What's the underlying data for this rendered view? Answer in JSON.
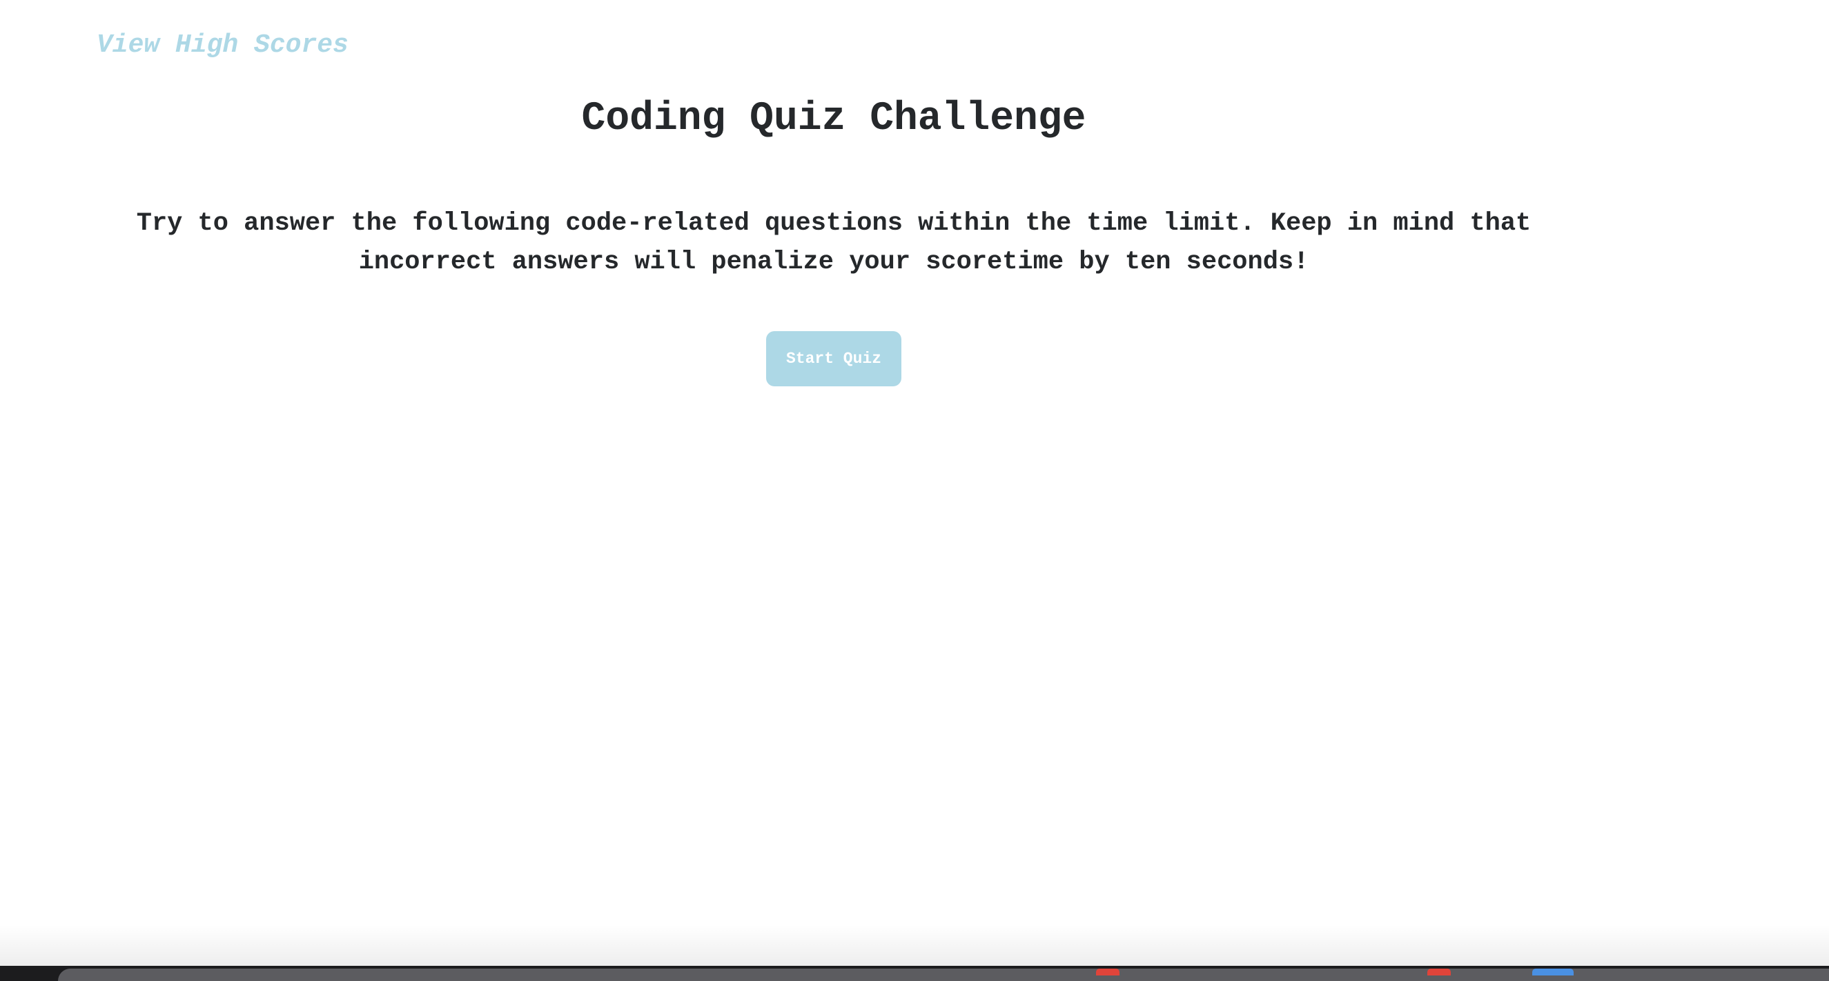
{
  "header": {
    "high_scores_label": "View High Scores"
  },
  "main": {
    "title": "Coding Quiz Challenge",
    "intro": "Try to answer the following code-related questions within the time limit. Keep in mind that incorrect answers will penalize your scoretime by ten seconds!",
    "start_label": "Start Quiz"
  },
  "colors": {
    "accent": "#add8e6",
    "text": "#25282b",
    "background": "#ffffff"
  }
}
